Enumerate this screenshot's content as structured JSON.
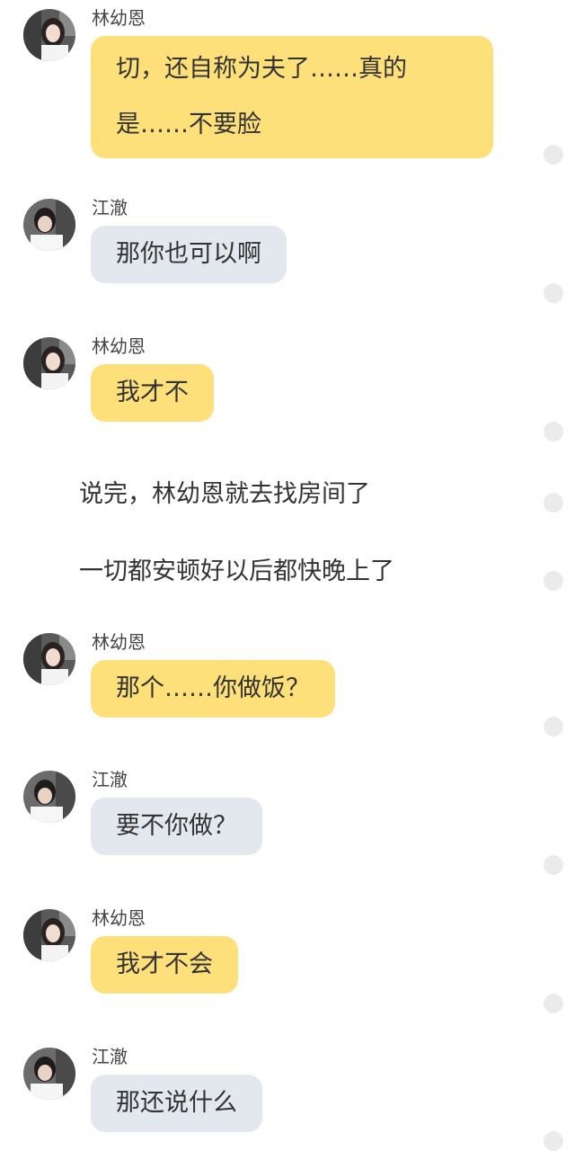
{
  "speakers": {
    "lin": {
      "name": "林幼恩"
    },
    "jiang": {
      "name": "江澈"
    }
  },
  "messages": [
    {
      "speaker": "林幼恩",
      "text": "切，还自称为夫了……真的是……不要脸"
    },
    {
      "speaker": "江澈",
      "text": "那你也可以啊"
    },
    {
      "speaker": "林幼恩",
      "text": "我才不"
    },
    {
      "narration": "说完，林幼恩就去找房间了"
    },
    {
      "narration": "一切都安顿好以后都快晚上了"
    },
    {
      "speaker": "林幼恩",
      "text": "那个……你做饭？"
    },
    {
      "speaker": "江澈",
      "text": "要不你做？"
    },
    {
      "speaker": "林幼恩",
      "text": "我才不会"
    },
    {
      "speaker": "江澈",
      "text": "那还说什么"
    }
  ],
  "colors": {
    "lin_bubble": "#fde07a",
    "jiang_bubble": "#e3e7ee",
    "side_dot": "#ebebeb"
  },
  "icons": {
    "avatar_lin": "girl-portrait-avatar",
    "avatar_jiang": "boy-portrait-avatar",
    "side_dot": "circle-indicator-icon"
  }
}
